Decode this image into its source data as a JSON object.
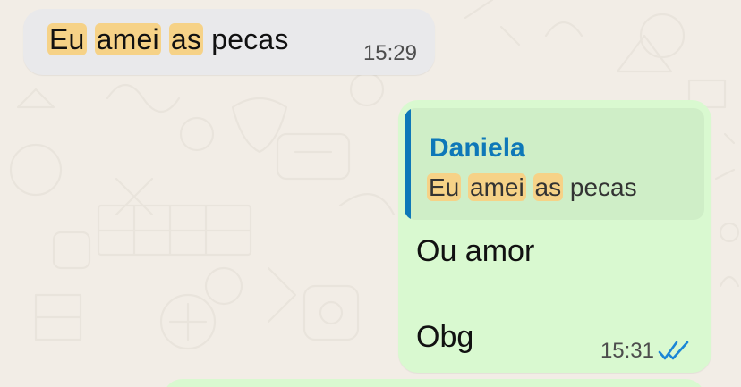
{
  "chat": {
    "incoming": {
      "words": [
        "Eu",
        "amei",
        "as",
        "pecas"
      ],
      "highlighted": [
        true,
        true,
        true,
        false
      ],
      "time": "15:29"
    },
    "outgoing": {
      "quote": {
        "sender": "Daniela",
        "words": [
          "Eu",
          "amei",
          "as",
          "pecas"
        ],
        "highlighted": [
          true,
          true,
          true,
          false
        ]
      },
      "lines": [
        "Ou amor",
        "Obg"
      ],
      "time": "15:31",
      "status_icon": "double-check-read-icon"
    }
  },
  "colors": {
    "background": "#f2ede6",
    "incoming_bubble": "#e9e9eb",
    "outgoing_bubble": "#d9f9d0",
    "quote_background": "#cfeec7",
    "quote_accent": "#0e78b8",
    "highlight": "#f6d287",
    "read_ticks": "#1a86d6"
  }
}
